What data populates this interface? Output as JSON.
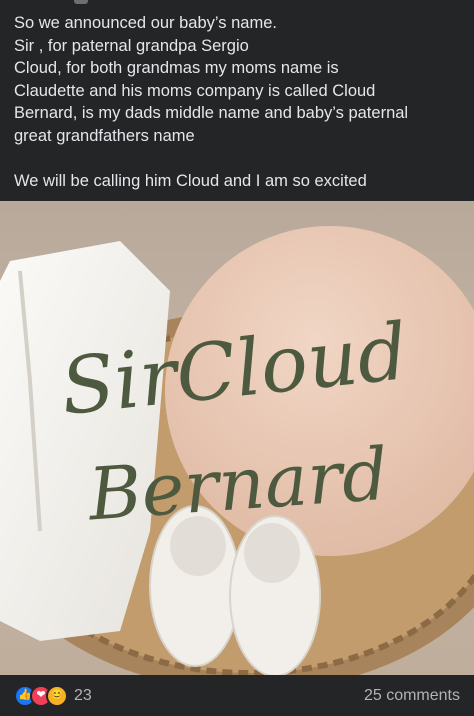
{
  "post": {
    "text": "So we announced our baby’s name.\nSir , for paternal grandpa Sergio\nCloud, for both grandmas my moms name is\nClaudette and his moms company is called Cloud\nBernard, is my dads middle name and baby’s paternal\ngreat grandfathers name\n\nWe will be calling him Cloud and I am so excited"
  },
  "photo": {
    "line1": "SirCloud",
    "line2": "Bernard",
    "script_color": "#4e5a40",
    "board_color": "#e9c9b6"
  },
  "reactions": {
    "icons": [
      "like-icon",
      "love-icon",
      "care-icon"
    ],
    "count": "23"
  },
  "comments": {
    "label": "25 comments"
  },
  "colors": {
    "background": "#242526",
    "text": "#e4e6eb",
    "muted": "#b0b3b8",
    "like_blue": "#1877f2",
    "love_red": "#f33e58"
  }
}
